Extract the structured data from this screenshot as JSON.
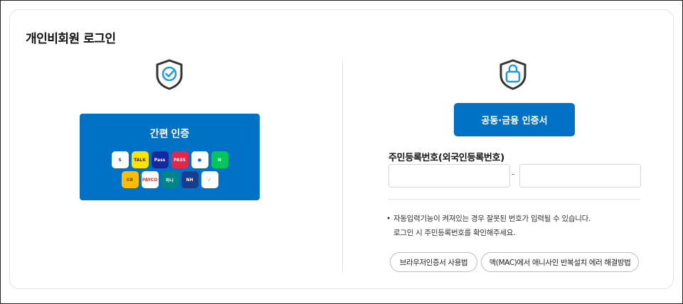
{
  "page": {
    "title": "개인비회원 로그인"
  },
  "left": {
    "shield_icon": "shield-check-icon",
    "easy_auth": {
      "label": "간편 인증",
      "apps_row1": [
        {
          "name": "shinhan-bank-app-icon",
          "text": "S",
          "bg": "#ffffff",
          "color": "#0046ff"
        },
        {
          "name": "kakao-talk-app-icon",
          "text": "TALK",
          "bg": "#fee500",
          "color": "#3c1e1e"
        },
        {
          "name": "samsung-pass-app-icon",
          "text": "Pass",
          "bg": "#1428a0",
          "color": "#ffffff"
        },
        {
          "name": "pass-app-icon",
          "text": "PASS",
          "bg": "#e5264b",
          "color": "#ffffff"
        },
        {
          "name": "toss-app-icon",
          "text": "●",
          "bg": "#ffffff",
          "color": "#0064ff"
        },
        {
          "name": "naver-app-icon",
          "text": "N",
          "bg": "#03c75a",
          "color": "#ffffff"
        }
      ],
      "apps_row2": [
        {
          "name": "kb-bank-app-icon",
          "text": "KB",
          "bg": "#ffbc00",
          "color": "#60584c"
        },
        {
          "name": "payco-app-icon",
          "text": "PAYCO",
          "bg": "#ffffff",
          "color": "#fa2828"
        },
        {
          "name": "hana-bank-app-icon",
          "text": "하나",
          "bg": "#008485",
          "color": "#ffffff"
        },
        {
          "name": "nh-bank-app-icon",
          "text": "NH",
          "bg": "#1a3c8e",
          "color": "#ffffff"
        },
        {
          "name": "kakao-bank-app-icon",
          "text": "✓",
          "bg": "#ffffff",
          "color": "#00b37e"
        }
      ]
    }
  },
  "right": {
    "lock_icon": "shield-lock-icon",
    "cert_button": "공동·금융 인증서",
    "rrn_label": "주민등록번호(외국인등록번호)",
    "rrn_front_value": "",
    "rrn_back_value": "",
    "rrn_separator": "-",
    "notice_line1": "자동입력기능이 켜져있는 경우 잘못된 번호가 입력될 수 있습니다.",
    "notice_line2": "로그인 시 주민등록번호를 확인해주세요.",
    "notice_bullet": "•",
    "help_browser_cert": "브라우저인증서 사용법",
    "help_mac_error": "맥(MAC)에서 애니사인 반복설치 에러 해결방법"
  },
  "colors": {
    "primary": "#0072c6",
    "shield_stroke": "#333333",
    "shield_accent": "#1f9bd7"
  }
}
